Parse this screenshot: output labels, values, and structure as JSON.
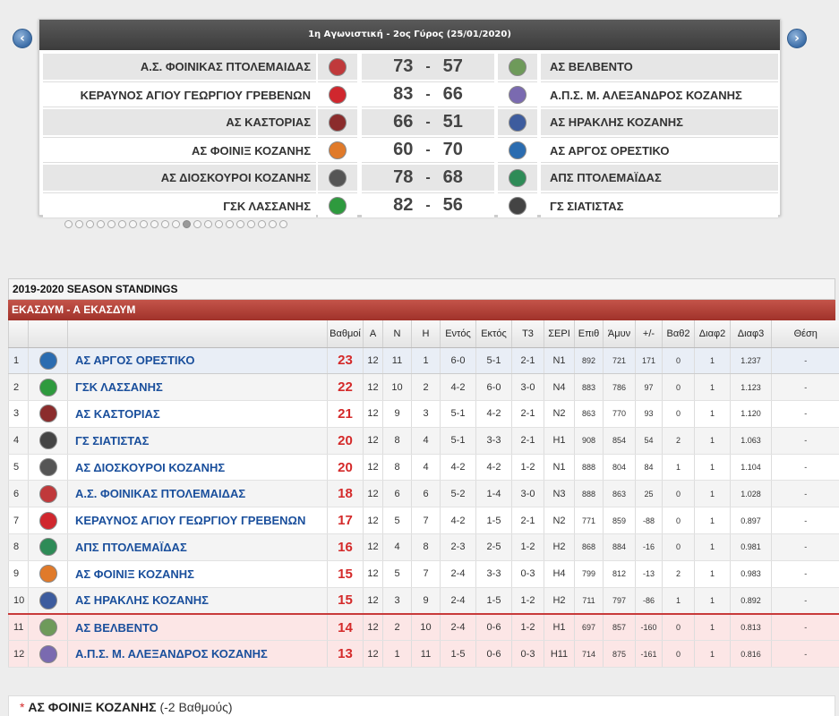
{
  "round": {
    "title": "1η Αγωνιστική - 2ος Γύρος (25/01/2020)"
  },
  "nav": {
    "prev_icon": "‹",
    "next_icon": "›"
  },
  "dots_count": 21,
  "dots_active": 11,
  "matches": [
    {
      "home": "Α.Σ. ΦΟΙΝΙΚΑΣ ΠΤΟΛΕΜΑΙΔΑΣ",
      "home_score": "73",
      "sep": "-",
      "away_score": "57",
      "away": "ΑΣ ΒΕΛΒΕΝΤΟ",
      "home_color": "#c0393b",
      "away_color": "#6e9a5a"
    },
    {
      "home": "ΚΕΡΑΥΝΟΣ ΑΓΙΟΥ ΓΕΩΡΓΙΟΥ ΓΡΕΒΕΝΩΝ",
      "home_score": "83",
      "sep": "-",
      "away_score": "66",
      "away": "Α.Π.Σ. Μ. ΑΛΕΞΑΝΔΡΟΣ ΚΟΖΑΝΗΣ",
      "home_color": "#d0272e",
      "away_color": "#7a6ab0"
    },
    {
      "home": "ΑΣ ΚΑΣΤΟΡΙΑΣ",
      "home_score": "66",
      "sep": "-",
      "away_score": "51",
      "away": "ΑΣ ΗΡΑΚΛΗΣ ΚΟΖΑΝΗΣ",
      "home_color": "#8b2c2c",
      "away_color": "#3d5c9e"
    },
    {
      "home": "ΑΣ ΦΟΙΝΙΞ ΚΟΖΑΝΗΣ",
      "home_score": "60",
      "sep": "-",
      "away_score": "70",
      "away": "ΑΣ ΑΡΓΟΣ ΟΡΕΣΤΙΚΟ",
      "home_color": "#e07a2a",
      "away_color": "#2b6cb0"
    },
    {
      "home": "ΑΣ ΔΙΟΣΚΟΥΡΟΙ ΚΟΖΑΝΗΣ",
      "home_score": "78",
      "sep": "-",
      "away_score": "68",
      "away": "ΑΠΣ ΠΤΟΛΕΜΑΪΔΑΣ",
      "home_color": "#555555",
      "away_color": "#2e8b57"
    },
    {
      "home": "ΓΣΚ ΛΑΣΣΑΝΗΣ",
      "home_score": "82",
      "sep": "-",
      "away_score": "56",
      "away": "ΓΣ ΣΙΑΤΙΣΤΑΣ",
      "home_color": "#2e9a3e",
      "away_color": "#444444"
    }
  ],
  "standings": {
    "title": "2019-2020 SEASON STANDINGS",
    "group": "ΕΚΑΣΔΥΜ - Α ΕΚΑΣΔΥΜ",
    "headers": [
      "",
      "",
      "",
      "Βαθμοί",
      "Α",
      "Ν",
      "Η",
      "Εντός",
      "Εκτός",
      "Τ3",
      "ΣΕΡΙ",
      "Επιθ",
      "Άμυν",
      "+/-",
      "Βαθ2",
      "Διαφ2",
      "Διαφ3",
      "Θέση"
    ],
    "rows": [
      {
        "pos": "1",
        "team": "ΑΣ ΑΡΓΟΣ ΟΡΕΣΤΙΚΟ",
        "color": "#2b6cb0",
        "pts": "23",
        "a": "12",
        "n": "11",
        "h": "1",
        "home": "6-0",
        "away": "5-1",
        "t3": "2-1",
        "seri": "N1",
        "epith": "892",
        "amyn": "721",
        "diff": "171",
        "vath2": "0",
        "diaf2": "1",
        "diaf3": "1.237",
        "thesi": "-"
      },
      {
        "pos": "2",
        "team": "ΓΣΚ ΛΑΣΣΑΝΗΣ",
        "color": "#2e9a3e",
        "pts": "22",
        "a": "12",
        "n": "10",
        "h": "2",
        "home": "4-2",
        "away": "6-0",
        "t3": "3-0",
        "seri": "N4",
        "epith": "883",
        "amyn": "786",
        "diff": "97",
        "vath2": "0",
        "diaf2": "1",
        "diaf3": "1.123",
        "thesi": "-"
      },
      {
        "pos": "3",
        "team": "ΑΣ ΚΑΣΤΟΡΙΑΣ",
        "color": "#8b2c2c",
        "pts": "21",
        "a": "12",
        "n": "9",
        "h": "3",
        "home": "5-1",
        "away": "4-2",
        "t3": "2-1",
        "seri": "N2",
        "epith": "863",
        "amyn": "770",
        "diff": "93",
        "vath2": "0",
        "diaf2": "1",
        "diaf3": "1.120",
        "thesi": "-"
      },
      {
        "pos": "4",
        "team": "ΓΣ ΣΙΑΤΙΣΤΑΣ",
        "color": "#444444",
        "pts": "20",
        "a": "12",
        "n": "8",
        "h": "4",
        "home": "5-1",
        "away": "3-3",
        "t3": "2-1",
        "seri": "H1",
        "epith": "908",
        "amyn": "854",
        "diff": "54",
        "vath2": "2",
        "diaf2": "1",
        "diaf3": "1.063",
        "thesi": "-"
      },
      {
        "pos": "5",
        "team": "ΑΣ ΔΙΟΣΚΟΥΡΟΙ ΚΟΖΑΝΗΣ",
        "color": "#555555",
        "pts": "20",
        "a": "12",
        "n": "8",
        "h": "4",
        "home": "4-2",
        "away": "4-2",
        "t3": "1-2",
        "seri": "N1",
        "epith": "888",
        "amyn": "804",
        "diff": "84",
        "vath2": "1",
        "diaf2": "1",
        "diaf3": "1.104",
        "thesi": "-"
      },
      {
        "pos": "6",
        "team": "Α.Σ. ΦΟΙΝΙΚΑΣ ΠΤΟΛΕΜΑΙΔΑΣ",
        "color": "#c0393b",
        "pts": "18",
        "a": "12",
        "n": "6",
        "h": "6",
        "home": "5-2",
        "away": "1-4",
        "t3": "3-0",
        "seri": "N3",
        "epith": "888",
        "amyn": "863",
        "diff": "25",
        "vath2": "0",
        "diaf2": "1",
        "diaf3": "1.028",
        "thesi": "-"
      },
      {
        "pos": "7",
        "team": "ΚΕΡΑΥΝΟΣ ΑΓΙΟΥ ΓΕΩΡΓΙΟΥ ΓΡΕΒΕΝΩΝ",
        "color": "#d0272e",
        "pts": "17",
        "a": "12",
        "n": "5",
        "h": "7",
        "home": "4-2",
        "away": "1-5",
        "t3": "2-1",
        "seri": "N2",
        "epith": "771",
        "amyn": "859",
        "diff": "-88",
        "vath2": "0",
        "diaf2": "1",
        "diaf3": "0.897",
        "thesi": "-"
      },
      {
        "pos": "8",
        "team": "ΑΠΣ ΠΤΟΛΕΜΑΪΔΑΣ",
        "color": "#2e8b57",
        "pts": "16",
        "a": "12",
        "n": "4",
        "h": "8",
        "home": "2-3",
        "away": "2-5",
        "t3": "1-2",
        "seri": "H2",
        "epith": "868",
        "amyn": "884",
        "diff": "-16",
        "vath2": "0",
        "diaf2": "1",
        "diaf3": "0.981",
        "thesi": "-"
      },
      {
        "pos": "9",
        "team": "ΑΣ ΦΟΙΝΙΞ ΚΟΖΑΝΗΣ",
        "color": "#e07a2a",
        "pts": "15",
        "a": "12",
        "n": "5",
        "h": "7",
        "home": "2-4",
        "away": "3-3",
        "t3": "0-3",
        "seri": "H4",
        "epith": "799",
        "amyn": "812",
        "diff": "-13",
        "vath2": "2",
        "diaf2": "1",
        "diaf3": "0.983",
        "thesi": "-"
      },
      {
        "pos": "10",
        "team": "ΑΣ ΗΡΑΚΛΗΣ ΚΟΖΑΝΗΣ",
        "color": "#3d5c9e",
        "pts": "15",
        "a": "12",
        "n": "3",
        "h": "9",
        "home": "2-4",
        "away": "1-5",
        "t3": "1-2",
        "seri": "H2",
        "epith": "711",
        "amyn": "797",
        "diff": "-86",
        "vath2": "1",
        "diaf2": "1",
        "diaf3": "0.892",
        "thesi": "-"
      },
      {
        "pos": "11",
        "team": "ΑΣ ΒΕΛΒΕΝΤΟ",
        "color": "#6e9a5a",
        "pts": "14",
        "a": "12",
        "n": "2",
        "h": "10",
        "home": "2-4",
        "away": "0-6",
        "t3": "1-2",
        "seri": "H1",
        "epith": "697",
        "amyn": "857",
        "diff": "-160",
        "vath2": "0",
        "diaf2": "1",
        "diaf3": "0.813",
        "thesi": "-"
      },
      {
        "pos": "12",
        "team": "Α.Π.Σ. Μ. ΑΛΕΞΑΝΔΡΟΣ ΚΟΖΑΝΗΣ",
        "color": "#7a6ab0",
        "pts": "13",
        "a": "12",
        "n": "1",
        "h": "11",
        "home": "1-5",
        "away": "0-6",
        "t3": "0-3",
        "seri": "H11",
        "epith": "714",
        "amyn": "875",
        "diff": "-161",
        "vath2": "0",
        "diaf2": "1",
        "diaf3": "0.816",
        "thesi": "-"
      }
    ]
  },
  "note": {
    "star": "*",
    "team": "ΑΣ ΦΟΙΝΙΞ ΚΟΖΑΝΗΣ",
    "penalty": "(-2 Βαθμούς)"
  }
}
